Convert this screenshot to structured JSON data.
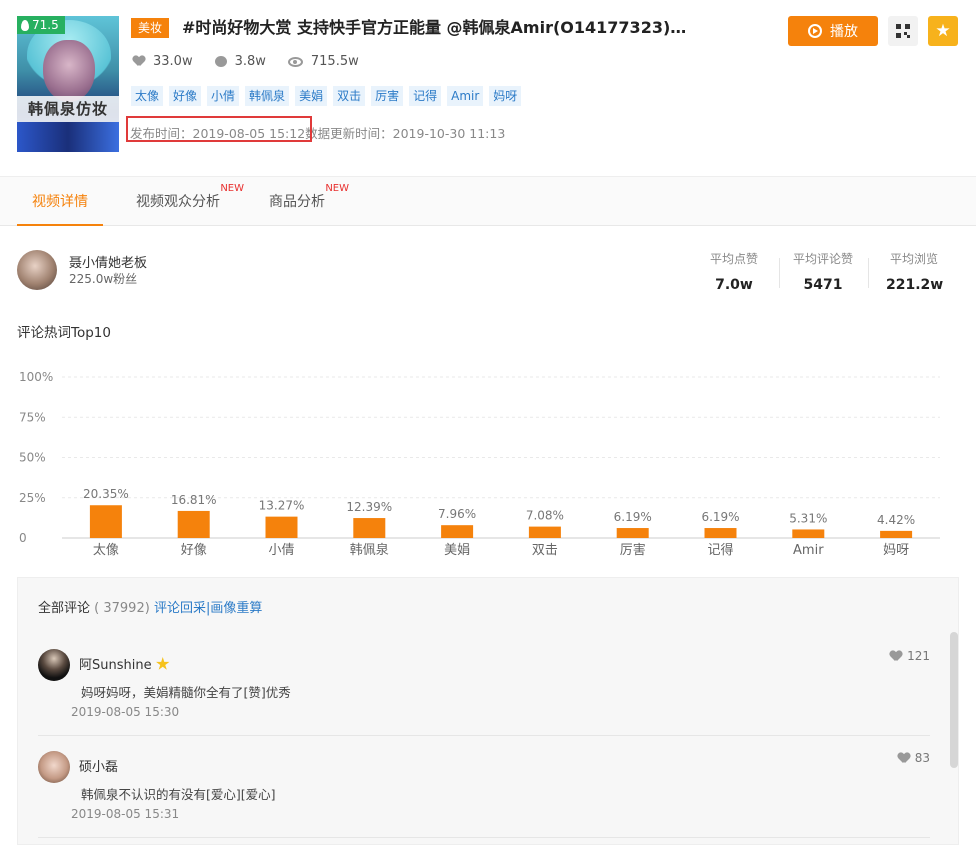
{
  "header": {
    "score": "71.5",
    "thumb_caption": "韩佩泉仿妆",
    "category": "美妆",
    "title": "#时尚好物大赏 支持快手官方正能量 @韩佩泉Amir(O14177323)韩...",
    "stats": {
      "likes": "33.0w",
      "comments": "3.8w",
      "views": "715.5w"
    },
    "tags": [
      "太像",
      "好像",
      "小倩",
      "韩佩泉",
      "美娟",
      "双击",
      "厉害",
      "记得",
      "Amir",
      "妈呀"
    ],
    "publish_time": "发布时间：2019-08-05 15:12",
    "update_time": "数据更新时间：2019-10-30 11:13",
    "play_label": "播放",
    "icons": {
      "qr": "qr-code-icon",
      "fav": "favorite-star-icon",
      "play": "play-circle-icon"
    },
    "colors": {
      "accent": "#f5820c",
      "score_green": "#27b060",
      "tag_blue": "#2c7bc7",
      "highlight_red": "#e03a3a"
    }
  },
  "tabs": [
    {
      "label": "视频详情",
      "new": "",
      "active": true
    },
    {
      "label": "视频观众分析",
      "new": "NEW",
      "active": false
    },
    {
      "label": "商品分析",
      "new": "NEW",
      "active": false
    }
  ],
  "author": {
    "name": "聂小倩她老板",
    "fans": "225.0w粉丝",
    "avg": [
      {
        "label": "平均点赞",
        "value": "7.0w"
      },
      {
        "label": "平均评论赞",
        "value": "5471"
      },
      {
        "label": "平均浏览",
        "value": "221.2w"
      }
    ]
  },
  "chart_title": "评论热词Top10",
  "chart_data": {
    "type": "bar",
    "categories": [
      "太像",
      "好像",
      "小倩",
      "韩佩泉",
      "美娟",
      "双击",
      "厉害",
      "记得",
      "Amir",
      "妈呀"
    ],
    "values": [
      20.35,
      16.81,
      13.27,
      12.39,
      7.96,
      7.08,
      6.19,
      6.19,
      5.31,
      4.42
    ],
    "value_labels": [
      "20.35%",
      "16.81%",
      "13.27%",
      "12.39%",
      "7.96%",
      "7.08%",
      "6.19%",
      "6.19%",
      "5.31%",
      "4.42%"
    ],
    "y_ticks": [
      "100%",
      "75%",
      "50%",
      "25%",
      "0"
    ],
    "ylim": [
      0,
      100
    ],
    "grid": true,
    "color": "#f5820c"
  },
  "comments": {
    "all_label": "全部评论",
    "count": "( 37992)",
    "link": "评论回采|画像重算",
    "items": [
      {
        "user": "阿Sunshine",
        "text": "妈呀妈呀，美娟精髓你全有了[赞]优秀",
        "date": "2019-08-05 15:30",
        "likes": "121"
      },
      {
        "user": "硕小磊",
        "text": "韩佩泉不认识的有没有[爱心][爱心]",
        "date": "2019-08-05 15:31",
        "likes": "83"
      }
    ]
  }
}
